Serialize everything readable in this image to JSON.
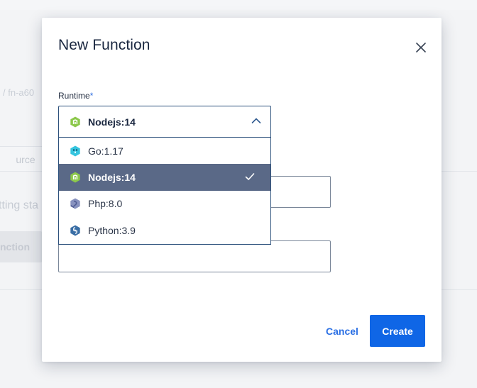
{
  "background": {
    "breadcrumb": "/ fn-a60",
    "tab_label": "urce",
    "status_text": "tting sta",
    "button_label": "nction"
  },
  "modal": {
    "title": "New Function",
    "runtime": {
      "label": "Runtime",
      "required_mark": "*",
      "selected_value": "Nodejs:14",
      "selected_icon": "nodejs-icon",
      "options": [
        {
          "label": "Go:1.17",
          "icon": "go-icon"
        },
        {
          "label": "Nodejs:14",
          "icon": "nodejs-icon",
          "selected": true
        },
        {
          "label": "Php:8.0",
          "icon": "php-icon"
        },
        {
          "label": "Python:3.9",
          "icon": "python-icon"
        }
      ]
    },
    "buttons": {
      "cancel": "Cancel",
      "create": "Create"
    }
  },
  "colors": {
    "primary": "#0f66e6",
    "selected_option_bg": "#5a6987",
    "title": "#19263f"
  }
}
